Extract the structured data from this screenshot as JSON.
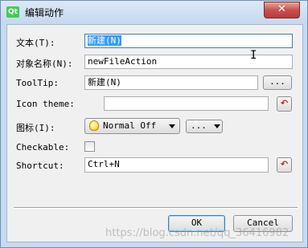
{
  "window": {
    "title": "编辑动作",
    "app_icon_text": "Qt",
    "close_symbol": "✕"
  },
  "form": {
    "text_label": "文本(T):",
    "text_value": "新建(N)",
    "object_name_label": "对象名称(N):",
    "object_name_value": "newFileAction",
    "tooltip_label": "ToolTip:",
    "tooltip_value": "新建(N)",
    "tooltip_more": "...",
    "icon_theme_label": "Icon theme:",
    "icon_theme_value": "",
    "icon_label": "图标(I):",
    "icon_mode_value": "Normal Off",
    "icon_more": "...",
    "checkable_label": "Checkable:",
    "shortcut_label": "Shortcut:",
    "shortcut_value": "Ctrl+N",
    "reset_symbol": "↶"
  },
  "buttons": {
    "ok": "OK",
    "cancel": "Cancel"
  },
  "watermark": "https://blog.csdn.net/qq_36416982"
}
